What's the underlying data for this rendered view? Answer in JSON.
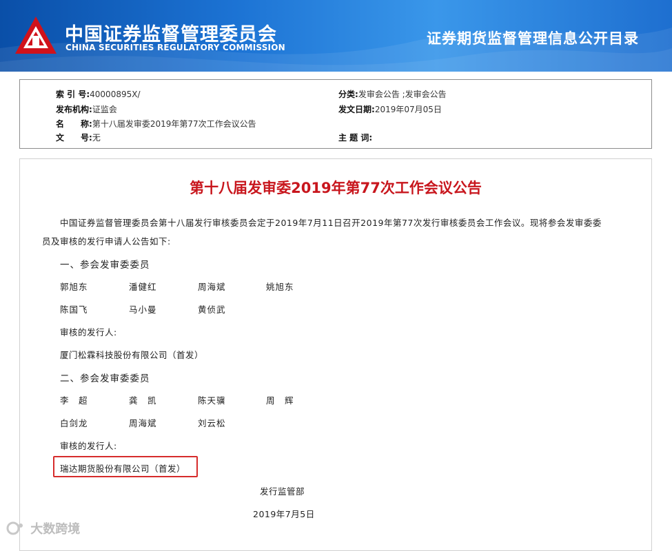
{
  "header": {
    "org_name_cn": "中国证券监督管理委员会",
    "org_name_en": "CHINA SECURITIES REGULATORY COMMISSION",
    "right_title": "证券期货监督管理信息公开目录"
  },
  "meta": {
    "index_label": "索 引 号:",
    "index_value": "40000895X/",
    "category_label": "分类:",
    "category_value": "发审会公告 ;发审会公告",
    "issuer_label": "发布机构:",
    "issuer_value": "证监会",
    "date_label": "发文日期:",
    "date_value": "2019年07月05日",
    "name_label": "名　　称:",
    "name_value": "第十八届发审委2019年第77次工作会议公告",
    "doc_no_label": "文　　号:",
    "doc_no_value": "无",
    "keywords_label": "主 题 词:",
    "keywords_value": ""
  },
  "article": {
    "title": "第十八届发审委2019年第77次工作会议公告",
    "intro_line1": "中国证券监督管理委员会第十八届发行审核委员会定于2019年7月11日召开2019年第77次发行审核委员会工作会议。现将参会发审委委",
    "intro_line2": "员及审核的发行申请人公告如下:",
    "section1_title": "一、参会发审委委员",
    "section1_members": [
      "郭旭东",
      "潘健红",
      "周海斌",
      "姚旭东",
      "陈国飞",
      "马小曼",
      "黄侦武"
    ],
    "section1_applicant_label": "审核的发行人:",
    "section1_applicant": "厦门松霖科技股份有限公司（首发）",
    "section2_title": "二、参会发审委委员",
    "section2_members": [
      "李　超",
      "龚　凯",
      "陈天骥",
      "周　辉",
      "白剑龙",
      "周海斌",
      "刘云松"
    ],
    "section2_applicant_label": "审核的发行人:",
    "section2_applicant": "瑞达期货股份有限公司（首发）",
    "signature_dept": "发行监管部",
    "signature_date": "2019年7月5日"
  },
  "watermark": {
    "text": "大数跨境"
  },
  "colors": {
    "header_blue": "#1c73d4",
    "title_red": "#c8161d",
    "highlight_red": "#d62b2b",
    "logo_red": "#d0121b"
  }
}
